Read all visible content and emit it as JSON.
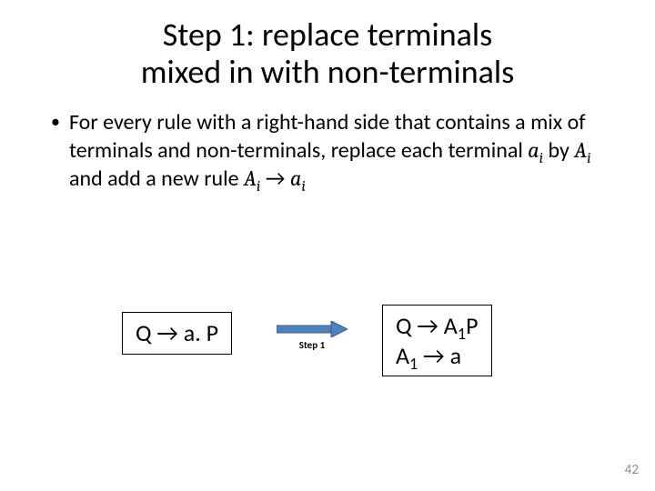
{
  "title": {
    "line1": "Step 1: replace terminals",
    "line2": "mixed in with non-terminals"
  },
  "body": {
    "part1": "For every rule with a right-hand side that contains a mix of terminals and non-terminals, replace each terminal ",
    "a": "a",
    "i": "i",
    "by": " by ",
    "A": "A",
    "part2": " and add a new rule ",
    "arrow": " → "
  },
  "diagram": {
    "before": "Q → a. P",
    "step_label": "Step 1",
    "after": {
      "q": "Q ",
      "arrow": "→ ",
      "A": "A",
      "one": "1",
      "P": "P",
      "a": "a"
    }
  },
  "page_number": "42"
}
